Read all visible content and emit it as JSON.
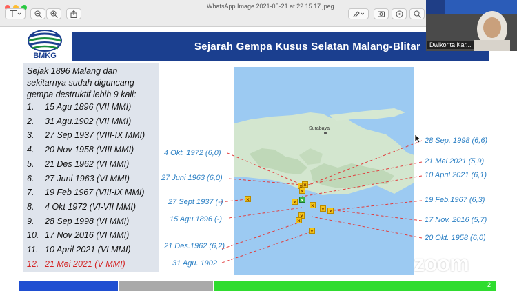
{
  "window": {
    "title": "WhatsApp Image 2021-05-21 at 22.15.17.jpeg"
  },
  "toolbar": {
    "icons": [
      "sidebar-icon",
      "zoom-out-icon",
      "zoom-in-icon",
      "share-icon",
      "markup-icon",
      "rotate-icon",
      "search-icon"
    ]
  },
  "slide": {
    "logo_text": "BMKG",
    "title": "Sejarah Gempa Kusus Selatan Malang-Blitar",
    "intro": "Sejak 1896 Malang dan sekitarnya sudah diguncang gempa destruktif lebih 9 kali:",
    "quakes": [
      {
        "num": "1.",
        "text": "15 Agu 1896 (VII MMI)"
      },
      {
        "num": "2.",
        "text": "31 Agu.1902 (VII MMI)"
      },
      {
        "num": "3.",
        "text": "27 Sep 1937 (VIII-IX MMI)"
      },
      {
        "num": "4.",
        "text": "20 Nov 1958 (VIII MMI)"
      },
      {
        "num": "5.",
        "text": "21 Des 1962 (VI MMI)"
      },
      {
        "num": "6.",
        "text": "27 Juni 1963 (VI MMI)"
      },
      {
        "num": "7.",
        "text": "19 Feb 1967 (VIII-IX MMI)"
      },
      {
        "num": "8.",
        "text": "4 Okt 1972 (VI-VII MMI)"
      },
      {
        "num": "9.",
        "text": "28 Sep 1998 (VI MMI)"
      },
      {
        "num": "10.",
        "text": "17 Nov 2016 (VI MMI)"
      },
      {
        "num": "11.",
        "text": "10 April 2021 (VI MMI)"
      },
      {
        "num": "12.",
        "text": "21 Mei 2021 (V MMI)"
      }
    ],
    "left_callouts": [
      "4 Okt. 1972 (6,0)",
      "27 Juni 1963 (6,0)",
      "27 Sept 1937 (-)",
      "15 Agu.1896 (-)",
      "21 Des.1962 (6,2)",
      "31 Agu. 1902"
    ],
    "right_callouts": [
      "28 Sep. 1998 (6,6)",
      "21 Mei 2021 (5,9)",
      "10 April 2021 (6,1)",
      "19 Feb.1967 (6,3)",
      "17 Nov. 2016 (5,7)",
      "20 Okt. 1958 (6,0)"
    ],
    "map_city": "Surabaya",
    "page_number": "2",
    "zoom_watermark": "zoom"
  },
  "video": {
    "participant_name": "Dwikorita Kar..."
  },
  "colors": {
    "title_bar": "#1b3f8f",
    "callout_text": "#2a7fc4",
    "leader_line": "#e23c3c",
    "highlight_item": "#d32222",
    "bar_blue": "#1f4ed1",
    "bar_gray": "#a9a9a9",
    "bar_green": "#2fdc2f"
  }
}
